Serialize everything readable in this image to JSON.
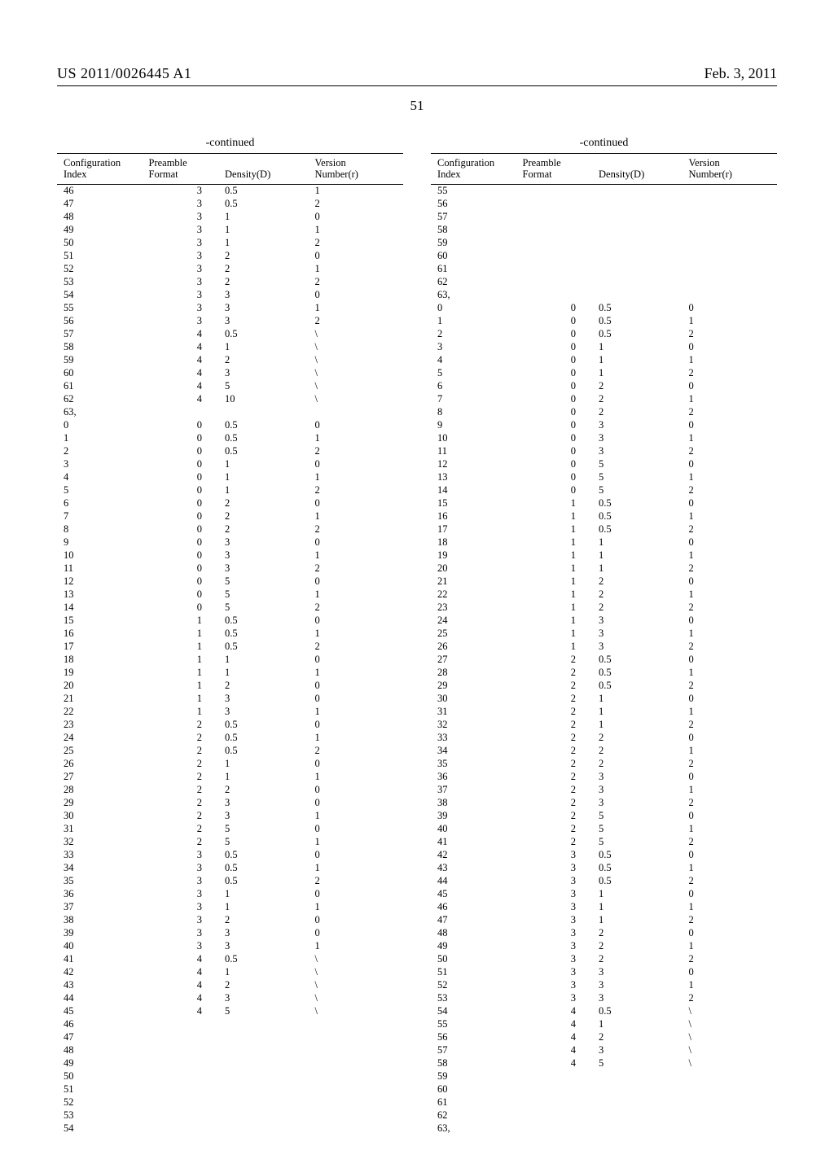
{
  "header": {
    "left": "US 2011/0026445 A1",
    "right": "Feb. 3, 2011",
    "pagenum": "51"
  },
  "labels": {
    "continued": "-continued",
    "col_config": "Configuration\nIndex",
    "col_preamble": "Preamble\nFormat",
    "col_density": "Density(D)",
    "col_version": "Version\nNumber(r)"
  },
  "left_rows": [
    [
      "46",
      "3",
      "0.5",
      "1"
    ],
    [
      "47",
      "3",
      "0.5",
      "2"
    ],
    [
      "48",
      "3",
      "1",
      "0"
    ],
    [
      "49",
      "3",
      "1",
      "1"
    ],
    [
      "50",
      "3",
      "1",
      "2"
    ],
    [
      "51",
      "3",
      "2",
      "0"
    ],
    [
      "52",
      "3",
      "2",
      "1"
    ],
    [
      "53",
      "3",
      "2",
      "2"
    ],
    [
      "54",
      "3",
      "3",
      "0"
    ],
    [
      "55",
      "3",
      "3",
      "1"
    ],
    [
      "56",
      "3",
      "3",
      "2"
    ],
    [
      "57",
      "4",
      "0.5",
      "\\"
    ],
    [
      "58",
      "4",
      "1",
      "\\"
    ],
    [
      "59",
      "4",
      "2",
      "\\"
    ],
    [
      "60",
      "4",
      "3",
      "\\"
    ],
    [
      "61",
      "4",
      "5",
      "\\"
    ],
    [
      "62",
      "4",
      "10",
      "\\"
    ],
    [
      "63,",
      "",
      "",
      ""
    ],
    [
      "0",
      "0",
      "0.5",
      "0"
    ],
    [
      "1",
      "0",
      "0.5",
      "1"
    ],
    [
      "2",
      "0",
      "0.5",
      "2"
    ],
    [
      "3",
      "0",
      "1",
      "0"
    ],
    [
      "4",
      "0",
      "1",
      "1"
    ],
    [
      "5",
      "0",
      "1",
      "2"
    ],
    [
      "6",
      "0",
      "2",
      "0"
    ],
    [
      "7",
      "0",
      "2",
      "1"
    ],
    [
      "8",
      "0",
      "2",
      "2"
    ],
    [
      "9",
      "0",
      "3",
      "0"
    ],
    [
      "10",
      "0",
      "3",
      "1"
    ],
    [
      "11",
      "0",
      "3",
      "2"
    ],
    [
      "12",
      "0",
      "5",
      "0"
    ],
    [
      "13",
      "0",
      "5",
      "1"
    ],
    [
      "14",
      "0",
      "5",
      "2"
    ],
    [
      "15",
      "1",
      "0.5",
      "0"
    ],
    [
      "16",
      "1",
      "0.5",
      "1"
    ],
    [
      "17",
      "1",
      "0.5",
      "2"
    ],
    [
      "18",
      "1",
      "1",
      "0"
    ],
    [
      "19",
      "1",
      "1",
      "1"
    ],
    [
      "20",
      "1",
      "2",
      "0"
    ],
    [
      "21",
      "1",
      "3",
      "0"
    ],
    [
      "22",
      "1",
      "3",
      "1"
    ],
    [
      "23",
      "2",
      "0.5",
      "0"
    ],
    [
      "24",
      "2",
      "0.5",
      "1"
    ],
    [
      "25",
      "2",
      "0.5",
      "2"
    ],
    [
      "26",
      "2",
      "1",
      "0"
    ],
    [
      "27",
      "2",
      "1",
      "1"
    ],
    [
      "28",
      "2",
      "2",
      "0"
    ],
    [
      "29",
      "2",
      "3",
      "0"
    ],
    [
      "30",
      "2",
      "3",
      "1"
    ],
    [
      "31",
      "2",
      "5",
      "0"
    ],
    [
      "32",
      "2",
      "5",
      "1"
    ],
    [
      "33",
      "3",
      "0.5",
      "0"
    ],
    [
      "34",
      "3",
      "0.5",
      "1"
    ],
    [
      "35",
      "3",
      "0.5",
      "2"
    ],
    [
      "36",
      "3",
      "1",
      "0"
    ],
    [
      "37",
      "3",
      "1",
      "1"
    ],
    [
      "38",
      "3",
      "2",
      "0"
    ],
    [
      "39",
      "3",
      "3",
      "0"
    ],
    [
      "40",
      "3",
      "3",
      "1"
    ],
    [
      "41",
      "4",
      "0.5",
      "\\"
    ],
    [
      "42",
      "4",
      "1",
      "\\"
    ],
    [
      "43",
      "4",
      "2",
      "\\"
    ],
    [
      "44",
      "4",
      "3",
      "\\"
    ],
    [
      "45",
      "4",
      "5",
      "\\"
    ],
    [
      "46",
      "",
      "",
      ""
    ],
    [
      "47",
      "",
      "",
      ""
    ],
    [
      "48",
      "",
      "",
      ""
    ],
    [
      "49",
      "",
      "",
      ""
    ],
    [
      "50",
      "",
      "",
      ""
    ],
    [
      "51",
      "",
      "",
      ""
    ],
    [
      "52",
      "",
      "",
      ""
    ],
    [
      "53",
      "",
      "",
      ""
    ],
    [
      "54",
      "",
      "",
      ""
    ]
  ],
  "right_rows": [
    [
      "55",
      "",
      "",
      ""
    ],
    [
      "56",
      "",
      "",
      ""
    ],
    [
      "57",
      "",
      "",
      ""
    ],
    [
      "58",
      "",
      "",
      ""
    ],
    [
      "59",
      "",
      "",
      ""
    ],
    [
      "60",
      "",
      "",
      ""
    ],
    [
      "61",
      "",
      "",
      ""
    ],
    [
      "62",
      "",
      "",
      ""
    ],
    [
      "63,",
      "",
      "",
      ""
    ],
    [
      "0",
      "0",
      "0.5",
      "0"
    ],
    [
      "1",
      "0",
      "0.5",
      "1"
    ],
    [
      "2",
      "0",
      "0.5",
      "2"
    ],
    [
      "3",
      "0",
      "1",
      "0"
    ],
    [
      "4",
      "0",
      "1",
      "1"
    ],
    [
      "5",
      "0",
      "1",
      "2"
    ],
    [
      "6",
      "0",
      "2",
      "0"
    ],
    [
      "7",
      "0",
      "2",
      "1"
    ],
    [
      "8",
      "0",
      "2",
      "2"
    ],
    [
      "9",
      "0",
      "3",
      "0"
    ],
    [
      "10",
      "0",
      "3",
      "1"
    ],
    [
      "11",
      "0",
      "3",
      "2"
    ],
    [
      "12",
      "0",
      "5",
      "0"
    ],
    [
      "13",
      "0",
      "5",
      "1"
    ],
    [
      "14",
      "0",
      "5",
      "2"
    ],
    [
      "15",
      "1",
      "0.5",
      "0"
    ],
    [
      "16",
      "1",
      "0.5",
      "1"
    ],
    [
      "17",
      "1",
      "0.5",
      "2"
    ],
    [
      "18",
      "1",
      "1",
      "0"
    ],
    [
      "19",
      "1",
      "1",
      "1"
    ],
    [
      "20",
      "1",
      "1",
      "2"
    ],
    [
      "21",
      "1",
      "2",
      "0"
    ],
    [
      "22",
      "1",
      "2",
      "1"
    ],
    [
      "23",
      "1",
      "2",
      "2"
    ],
    [
      "24",
      "1",
      "3",
      "0"
    ],
    [
      "25",
      "1",
      "3",
      "1"
    ],
    [
      "26",
      "1",
      "3",
      "2"
    ],
    [
      "27",
      "2",
      "0.5",
      "0"
    ],
    [
      "28",
      "2",
      "0.5",
      "1"
    ],
    [
      "29",
      "2",
      "0.5",
      "2"
    ],
    [
      "30",
      "2",
      "1",
      "0"
    ],
    [
      "31",
      "2",
      "1",
      "1"
    ],
    [
      "32",
      "2",
      "1",
      "2"
    ],
    [
      "33",
      "2",
      "2",
      "0"
    ],
    [
      "34",
      "2",
      "2",
      "1"
    ],
    [
      "35",
      "2",
      "2",
      "2"
    ],
    [
      "36",
      "2",
      "3",
      "0"
    ],
    [
      "37",
      "2",
      "3",
      "1"
    ],
    [
      "38",
      "2",
      "3",
      "2"
    ],
    [
      "39",
      "2",
      "5",
      "0"
    ],
    [
      "40",
      "2",
      "5",
      "1"
    ],
    [
      "41",
      "2",
      "5",
      "2"
    ],
    [
      "42",
      "3",
      "0.5",
      "0"
    ],
    [
      "43",
      "3",
      "0.5",
      "1"
    ],
    [
      "44",
      "3",
      "0.5",
      "2"
    ],
    [
      "45",
      "3",
      "1",
      "0"
    ],
    [
      "46",
      "3",
      "1",
      "1"
    ],
    [
      "47",
      "3",
      "1",
      "2"
    ],
    [
      "48",
      "3",
      "2",
      "0"
    ],
    [
      "49",
      "3",
      "2",
      "1"
    ],
    [
      "50",
      "3",
      "2",
      "2"
    ],
    [
      "51",
      "3",
      "3",
      "0"
    ],
    [
      "52",
      "3",
      "3",
      "1"
    ],
    [
      "53",
      "3",
      "3",
      "2"
    ],
    [
      "54",
      "4",
      "0.5",
      "\\"
    ],
    [
      "55",
      "4",
      "1",
      "\\"
    ],
    [
      "56",
      "4",
      "2",
      "\\"
    ],
    [
      "57",
      "4",
      "3",
      "\\"
    ],
    [
      "58",
      "4",
      "5",
      "\\"
    ],
    [
      "59",
      "",
      "",
      ""
    ],
    [
      "60",
      "",
      "",
      ""
    ],
    [
      "61",
      "",
      "",
      ""
    ],
    [
      "62",
      "",
      "",
      ""
    ],
    [
      "63,",
      "",
      "",
      ""
    ]
  ]
}
